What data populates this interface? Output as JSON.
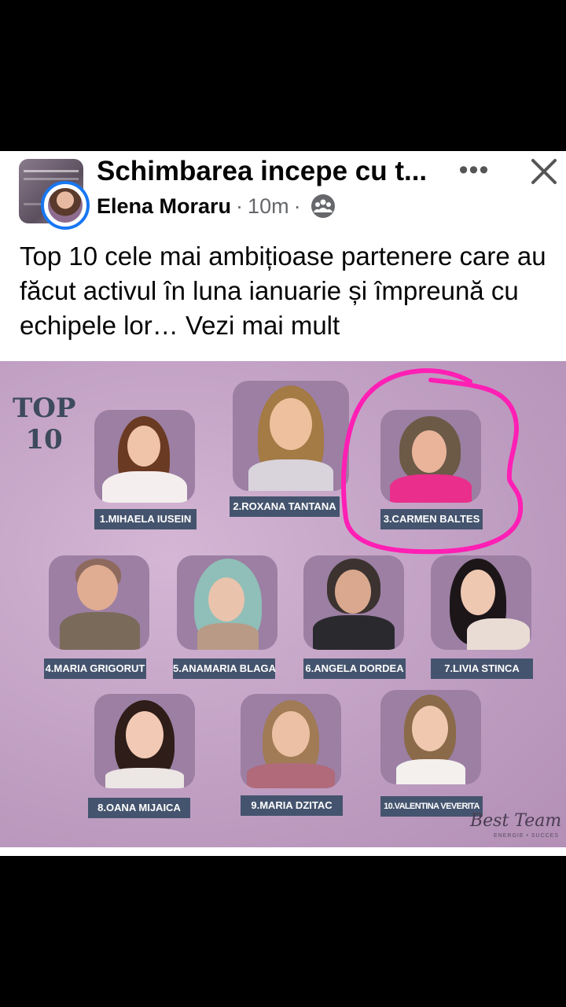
{
  "post": {
    "group_name": "Schimbarea incepe cu t...",
    "author": "Elena Moraru",
    "separator": "·",
    "time": "10m",
    "more_label": "•••",
    "text": "Top 10 cele mai ambițioase partenere care au făcut activul în luna ianuarie și împreună cu echipele lor… ",
    "see_more": "Vezi mai mult"
  },
  "image": {
    "heading_line1": "TOP",
    "heading_line2": "10",
    "brand": "Best Team",
    "brand_sub": "ENERGIE • SUCCES",
    "entries": [
      {
        "label": "2.ROXANA TANTANA"
      },
      {
        "label": "1.MIHAELA IUSEIN"
      },
      {
        "label": "3.CARMEN BALTES"
      },
      {
        "label": "4.MARIA GRIGORUT"
      },
      {
        "label": "5.ANAMARIA BLAGA"
      },
      {
        "label": "6.ANGELA DORDEA"
      },
      {
        "label": "7.LIVIA STINCA"
      },
      {
        "label": "8.OANA MIJAICA"
      },
      {
        "label": "9.MARIA DZITAC"
      },
      {
        "label": "10.VALENTINA VEVERITA"
      }
    ]
  },
  "icons": {
    "more": "more-options-icon",
    "close": "close-icon",
    "audience": "group-audience-icon"
  },
  "colors": {
    "accent": "#1877f2",
    "highlight_circle": "#ff1fb4",
    "label_bg": "#45546e"
  }
}
